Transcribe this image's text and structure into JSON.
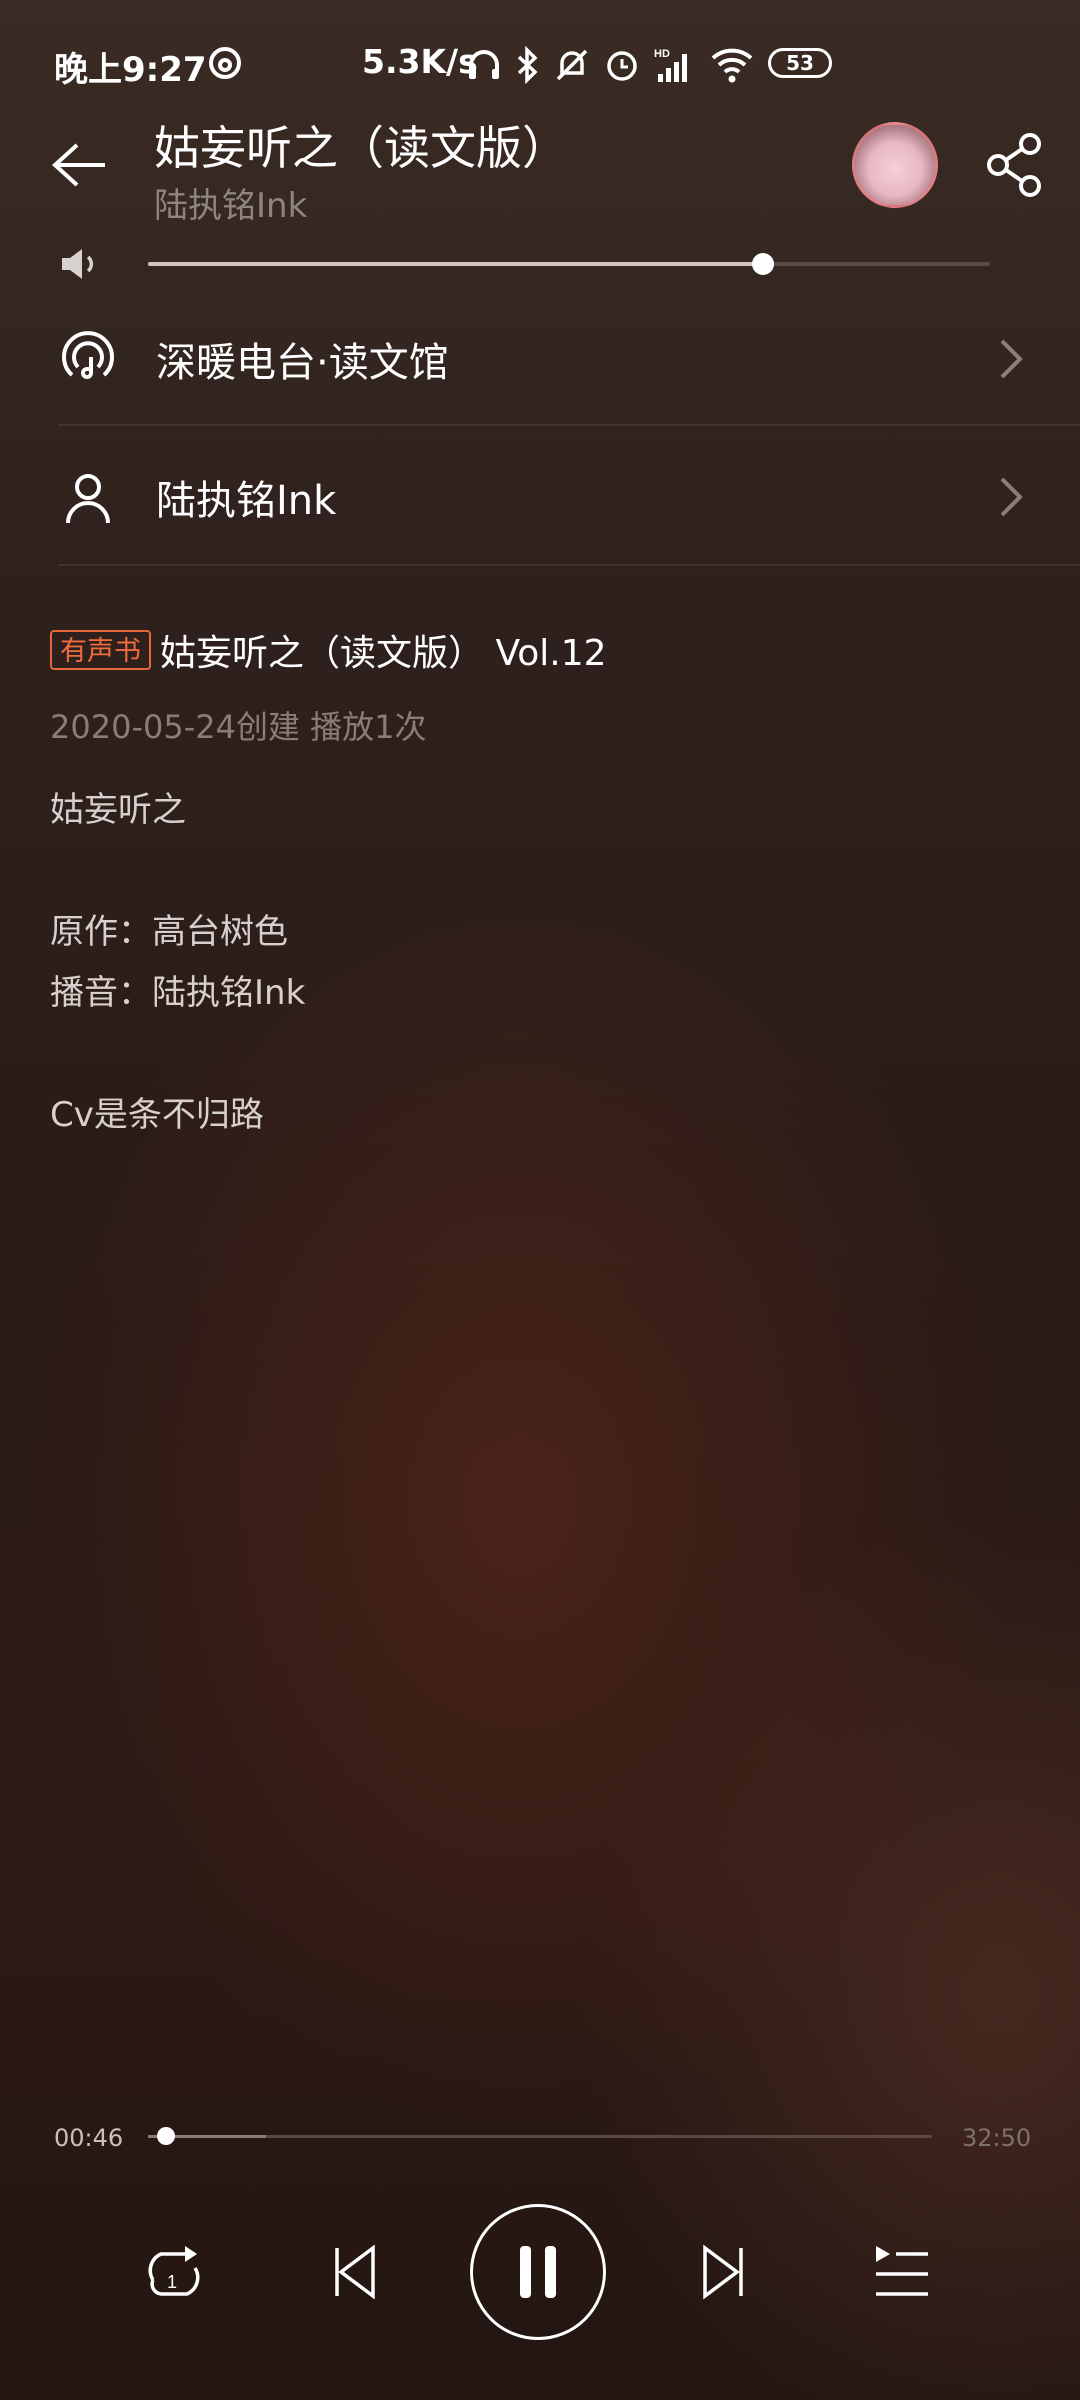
{
  "status_bar": {
    "time": "晚上9:27",
    "net_speed": "5.3K/s",
    "battery": "53",
    "icons": [
      "netease-music-icon",
      "headphone-icon",
      "bluetooth-icon",
      "mute-bell-icon",
      "alarm-icon",
      "hd-signal-icon",
      "wifi-icon",
      "battery-icon"
    ]
  },
  "header": {
    "title": "姑妄听之（读文版）",
    "subtitle": "陆执铭Ink"
  },
  "volume": {
    "level": 0.73
  },
  "rows": [
    {
      "label": "深暖电台·读文馆",
      "icon": "podcast-icon"
    },
    {
      "label": "陆执铭Ink",
      "icon": "user-icon"
    }
  ],
  "episode": {
    "tag": "有声书",
    "title": "姑妄听之（读文版） Vol.12",
    "meta": "2020-05-24创建 播放1次",
    "description": [
      "姑妄听之",
      "",
      "原作：高台树色",
      "播音：陆执铭Ink",
      "",
      "Cv是条不归路"
    ]
  },
  "player": {
    "elapsed": "00:46",
    "total": "32:50",
    "progress": 0.023,
    "buffered": 0.15,
    "controls": [
      "repeat-one-icon",
      "previous-icon",
      "pause-icon",
      "next-icon",
      "playlist-icon"
    ]
  },
  "colors": {
    "accent_tag": "#f26b3f",
    "muted_text": "#8a7d78"
  }
}
